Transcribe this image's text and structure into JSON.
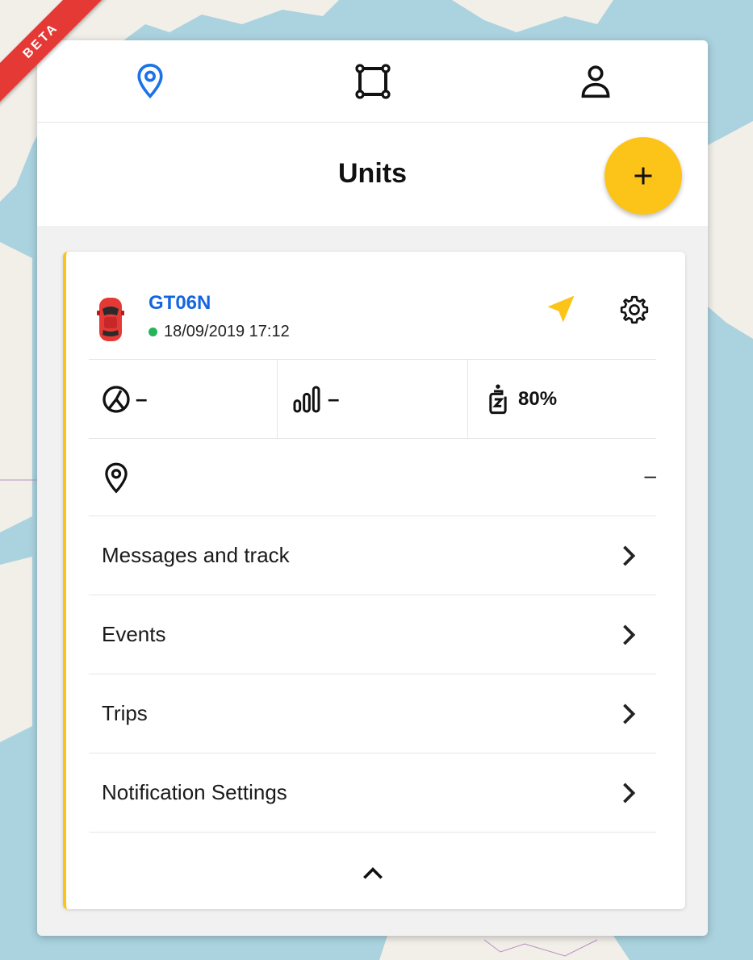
{
  "beta_label": "BETA",
  "colors": {
    "accent": "#fcc419",
    "link": "#1565e0",
    "online": "#26b35a",
    "beta": "#e53935"
  },
  "nav": {
    "tabs": [
      {
        "name": "units",
        "icon": "location-pin-icon",
        "active": true
      },
      {
        "name": "geofences",
        "icon": "square-shape-icon",
        "active": false
      },
      {
        "name": "account",
        "icon": "user-icon",
        "active": false
      }
    ]
  },
  "header": {
    "title": "Units",
    "add_icon": "plus-icon"
  },
  "unit": {
    "name": "GT06N",
    "last_update": "18/09/2019 17:12",
    "status": "online",
    "speed": "–",
    "signal": "–",
    "battery": "80%",
    "location": "–"
  },
  "menu": {
    "items": [
      {
        "label": "Messages and track"
      },
      {
        "label": "Events"
      },
      {
        "label": "Trips"
      },
      {
        "label": "Notification Settings"
      }
    ]
  }
}
